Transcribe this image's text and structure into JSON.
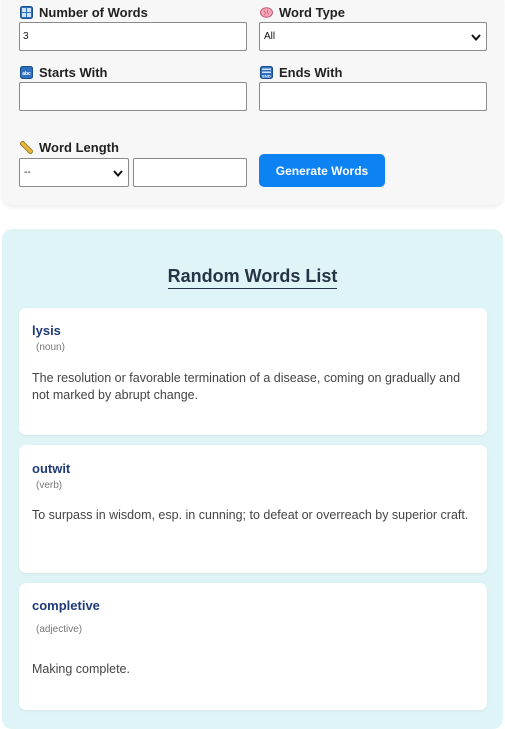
{
  "form": {
    "number_of_words": {
      "label": "Number of Words",
      "value": "3"
    },
    "word_type": {
      "label": "Word Type",
      "selected": "All"
    },
    "starts_with": {
      "label": "Starts With",
      "value": ""
    },
    "ends_with": {
      "label": "Ends With",
      "value": ""
    },
    "word_length": {
      "label": "Word Length",
      "selected": "--",
      "value": ""
    },
    "generate_label": "Generate Words"
  },
  "list": {
    "title": "Random Words List",
    "words": [
      {
        "word": "lysis",
        "pos": "(noun)",
        "definition": "The resolution or favorable termination of a disease, coming on gradually and not marked by abrupt change."
      },
      {
        "word": "outwit",
        "pos": "(verb)",
        "definition": "To surpass in wisdom, esp. in cunning; to defeat or overreach by superior craft."
      },
      {
        "word": "completive",
        "pos": "(adjective)",
        "definition": "Making complete."
      }
    ]
  },
  "colors": {
    "accent": "#0d82f2",
    "panel": "#dff4f7",
    "word_title": "#1f3a78"
  },
  "icons": {
    "number_of_words": "numbers-icon",
    "word_type": "brain-icon",
    "starts_with": "abc-icon",
    "ends_with": "end-icon",
    "word_length": "ruler-icon"
  }
}
